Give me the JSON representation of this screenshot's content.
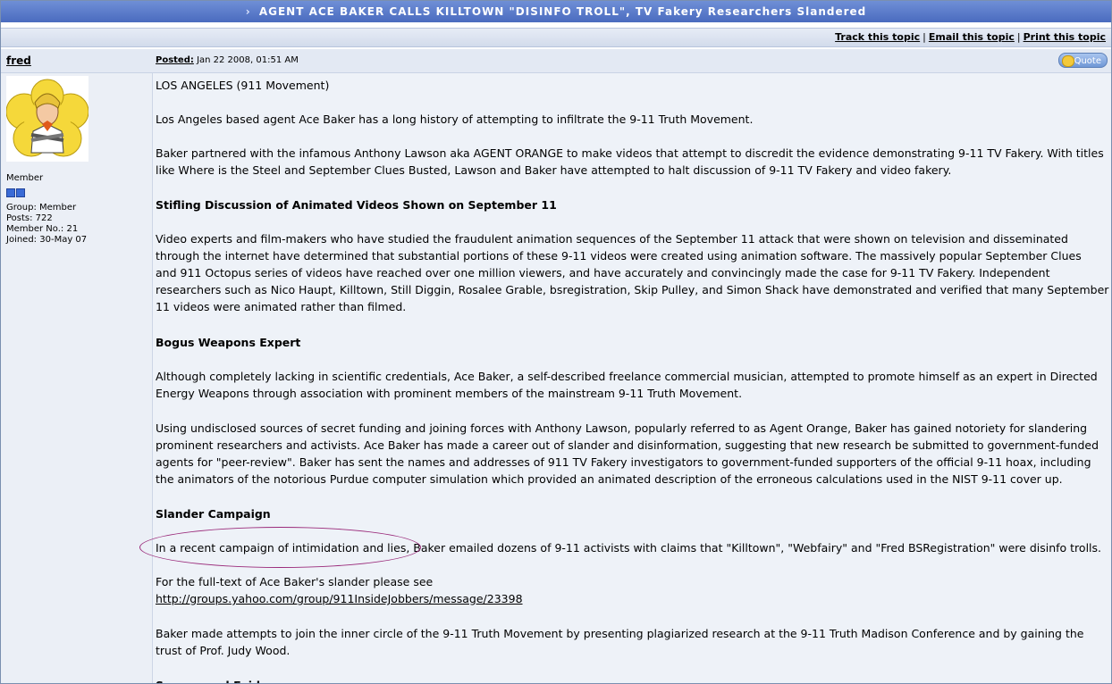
{
  "topic": {
    "title": "AGENT ACE BAKER CALLS KILLTOWN \"DISINFO TROLL\", TV Fakery Researchers Slandered",
    "title_arrow": "›"
  },
  "topic_links": {
    "track": "Track this topic",
    "email": "Email this topic",
    "print": "Print this topic",
    "separator": "|"
  },
  "post": {
    "author": "fred",
    "posted_label": "Posted:",
    "posted_date": "Jan 22 2008, 01:51 AM",
    "quote_label": "Quote"
  },
  "user": {
    "rank": "Member",
    "group": "Group: Member",
    "posts": "Posts: 722",
    "member_no": "Member No.: 21",
    "joined": "Joined: 30-May 07"
  },
  "body": {
    "p1": "LOS ANGELES (911 Movement)",
    "p2": "Los Angeles based agent Ace Baker has a long history of attempting to infiltrate the 9-11 Truth Movement.",
    "p3a": "Baker partnered with the infamous Anthony Lawson aka AGENT ORANGE to make videos that attempt to discredit the evidence demonstrating 9-11 TV Fakery. With titles",
    "p3b": "like Where is the Steel and September Clues Busted, Lawson and Baker have attempted to halt discussion of 9-11 TV Fakery and video fakery.",
    "h1": "Stifling Discussion of Animated Videos Shown on September 11",
    "p4a": "Video experts and film-makers who have studied the fraudulent animation sequences of the September 11 attack that were shown on television and disseminated",
    "p4b": "through the internet have determined that substantial portions of these 9-11 videos were created using animation software. The massively popular September Clues",
    "p4c": "and 911 Octopus series of videos have reached over one million viewers, and have accurately and convincingly made the case for 9-11 TV Fakery. Independent",
    "p4d": "researchers such as Nico Haupt, Killtown, Still Diggin, Rosalee Grable, bsregistration, Skip Pulley, and Simon Shack have demonstrated and verified that many September",
    "p4e": "11 videos were animated rather than filmed.",
    "h2": "Bogus Weapons Expert",
    "p5a": "Although completely lacking in scientific credentials, Ace Baker, a self-described freelance commercial musician, attempted to promote himself as an expert in Directed",
    "p5b": "Energy Weapons through association with prominent members of the mainstream 9-11 Truth Movement.",
    "p6a": "Using undisclosed sources of secret funding and joining forces with Anthony Lawson, popularly referred to as Agent Orange, Baker has gained notoriety for slandering",
    "p6b": "prominent researchers and activists. Ace Baker has made a career out of slander and disinformation, suggesting that new research be submitted to government-funded",
    "p6c": "agents for \"peer-review\". Baker has sent the names and addresses of 911 TV Fakery investigators to government-funded supporters of the official 9-11 hoax, including",
    "p6d": "the animators of the notorious Purdue computer simulation which provided an animated description of the erroneous calculations used in the NIST 9-11 cover up.",
    "h3": "Slander Campaign",
    "p7": "In a recent campaign of intimidation and lies, Baker emailed dozens of 9-11 activists with claims that \"Killtown\", \"Webfairy\" and \"Fred BSRegistration\" were disinfo trolls.",
    "p8": "For the full-text of Ace Baker's slander please see",
    "link": "http://groups.yahoo.com/group/911InsideJobbers/message/23398",
    "p9a": "Baker made attempts to join the inner circle of the 9-11 Truth Movement by presenting plagiarized research at the 9-11 Truth Madison Conference and by gaining the",
    "p9b": "trust of Prof. Judy Wood.",
    "h4": "Suppressed Evidence"
  }
}
